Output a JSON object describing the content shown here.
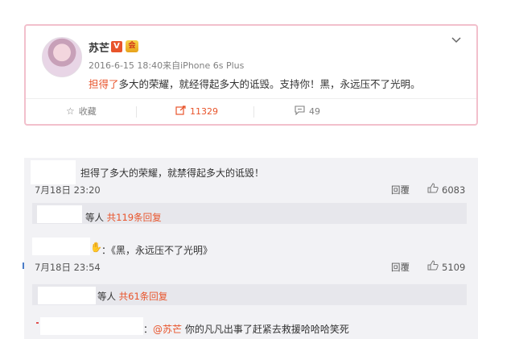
{
  "post": {
    "username": "苏芒",
    "v_badge": "V",
    "vip_badge": "会",
    "time": "2016-6-15 18:40",
    "source": "来自iPhone 6s Plus",
    "text_highlight": "担得了",
    "text_rest": "多大的荣耀，就经得起多大的诋毁。支持你！黑，永远压不了光明。",
    "actions": {
      "favorite_label": "收藏",
      "repost_count": "11329",
      "comment_count": "49"
    },
    "accent_color": "#e8542b"
  },
  "comments": [
    {
      "text": "担得了多大的荣耀，就禁得起多大的诋毁！",
      "time": "7月18日 23:20",
      "reply_label": "回覆",
      "likes": "6083",
      "sub_prefix": "等人",
      "sub_count": "共119条回复"
    },
    {
      "text": "：《黑，永远压不了光明》",
      "time": "7月18日 23:54",
      "reply_label": "回覆",
      "likes": "5109",
      "sub_prefix": "等人",
      "sub_count": "共61条回复"
    },
    {
      "mention": "@苏芒",
      "text": "你的凡凡出事了赶紧去救援哈哈哈笑死"
    }
  ]
}
